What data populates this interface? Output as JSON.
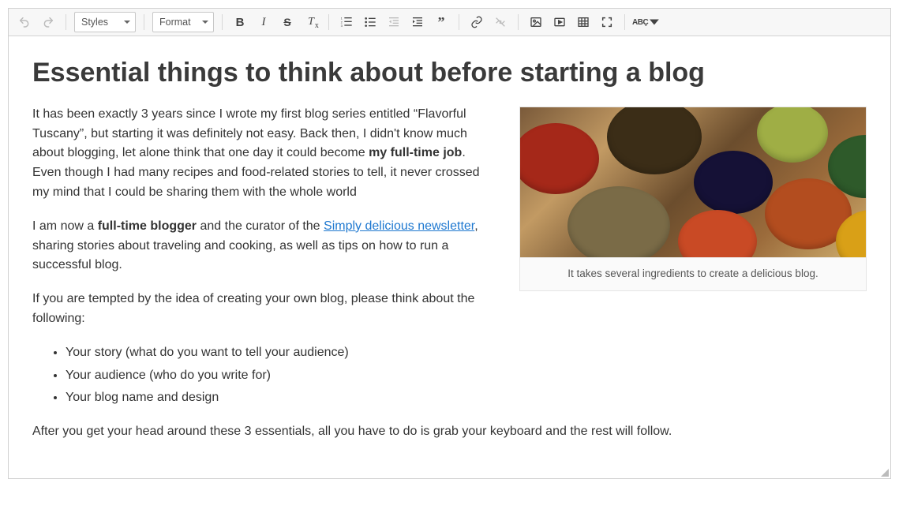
{
  "toolbar": {
    "styles_label": "Styles",
    "format_label": "Format"
  },
  "doc": {
    "title": "Essential things to think about before starting a blog",
    "p1_a": "It has been exactly 3 years since I wrote my first blog series entitled “Flavorful Tuscany”, but starting it was definitely not easy. Back then, I didn't know much about blogging, let alone think that one day it could become ",
    "p1_bold": "my full-time job",
    "p1_b": ". Even though I had many recipes and food-related stories to tell, it never crossed my mind that I could be sharing them with the whole world",
    "p2_a": "I am now a ",
    "p2_bold": "full-time blogger",
    "p2_b": " and the curator of the ",
    "p2_link": "Simply delicious newsletter",
    "p2_c": ", sharing stories about traveling and cooking, as well as tips on how to run a successful blog.",
    "p3": "If you are tempted by the idea of creating your own blog, please think about the following:",
    "list": [
      "Your story (what do you want to tell your audience)",
      "Your audience (who do you write for)",
      "Your blog name and design"
    ],
    "p4": "After you get your head around these 3 essentials, all you have to do is grab your keyboard and the rest will follow.",
    "caption": "It takes several ingredients to create a delicious blog."
  }
}
